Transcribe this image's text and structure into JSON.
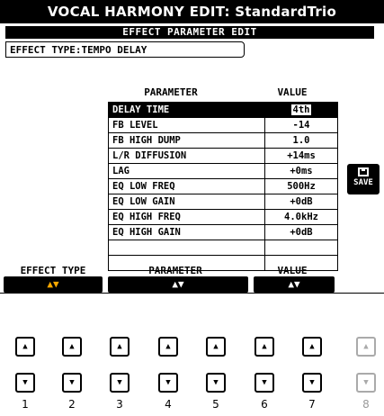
{
  "title": "VOCAL HARMONY EDIT: StandardTrio",
  "subtitle": "EFFECT PARAMETER EDIT",
  "effect_type": "EFFECT TYPE:TEMPO DELAY",
  "table": {
    "param_header": "PARAMETER",
    "value_header": "VALUE",
    "rows": [
      {
        "name": "DELAY TIME",
        "value": "4th"
      },
      {
        "name": "FB LEVEL",
        "value": "-14"
      },
      {
        "name": "FB HIGH DUMP",
        "value": "1.0"
      },
      {
        "name": "L/R DIFFUSION",
        "value": "+14ms"
      },
      {
        "name": "LAG",
        "value": "+0ms"
      },
      {
        "name": "EQ LOW FREQ",
        "value": "500Hz"
      },
      {
        "name": "EQ LOW GAIN",
        "value": "+0dB"
      },
      {
        "name": "EQ HIGH FREQ",
        "value": "4.0kHz"
      },
      {
        "name": "EQ HIGH GAIN",
        "value": "+0dB"
      }
    ]
  },
  "save_label": "SAVE",
  "bottom": {
    "effect_type": "EFFECT TYPE",
    "parameter": "PARAMETER",
    "value": "VALUE",
    "arrows": "▲▼"
  },
  "hw_numbers": [
    "1",
    "2",
    "3",
    "4",
    "5",
    "6",
    "7",
    "8"
  ],
  "hw_up_glyph": "▲",
  "hw_down_glyph": "▼",
  "accent_color": "#f7a800"
}
